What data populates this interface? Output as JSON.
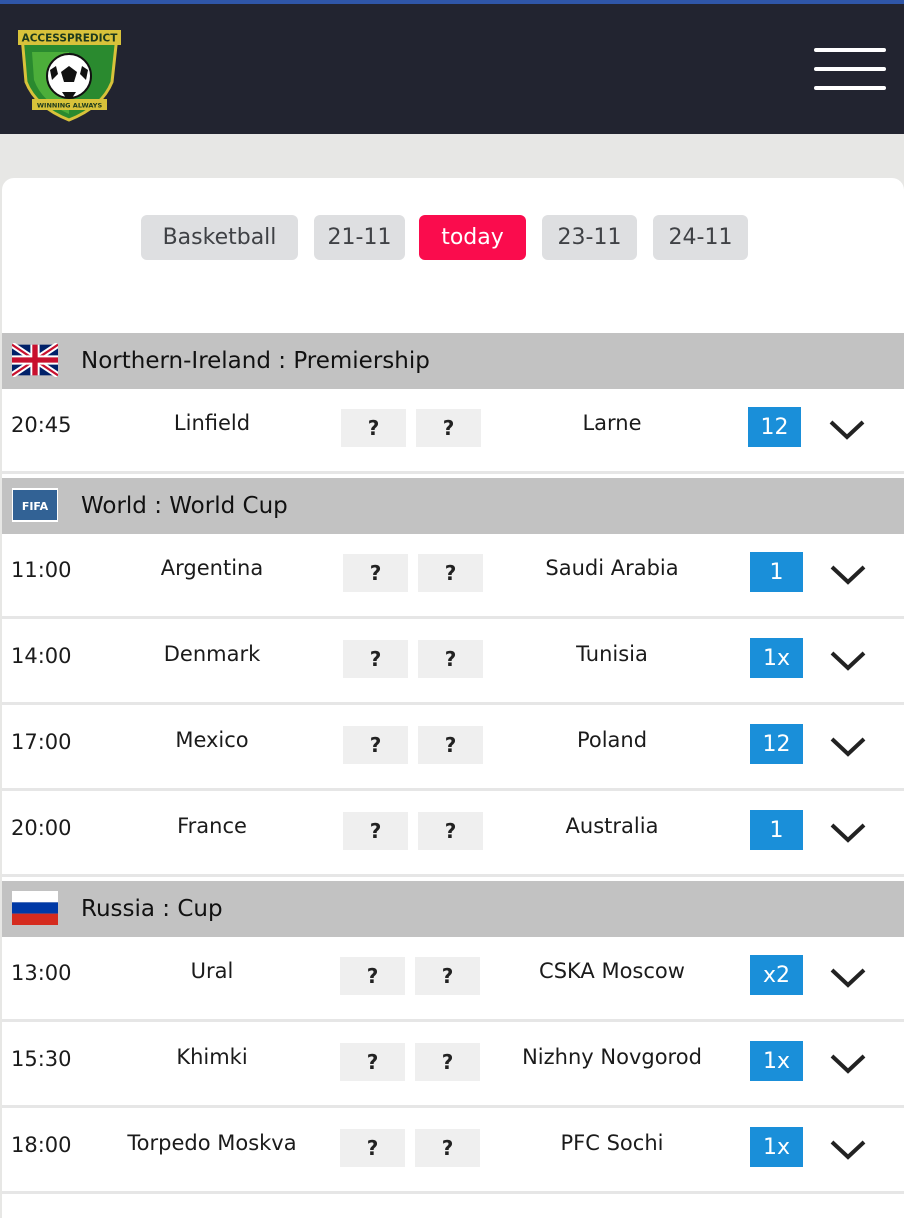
{
  "header": {
    "logo_title": "ACCESSPREDICT",
    "logo_tagline": "WINNING ALWAYS",
    "menu_icon": "hamburger-menu-icon",
    "background_color": "#222430"
  },
  "date_tabs": [
    {
      "label": "Basketball",
      "active": false
    },
    {
      "label": "21-11",
      "active": false
    },
    {
      "label": "today",
      "active": true
    },
    {
      "label": "23-11",
      "active": false
    },
    {
      "label": "24-11",
      "active": false
    }
  ],
  "colors": {
    "active_tab": "#fa0c4d",
    "tip_badge": "#1a8fd9",
    "league_bar": "#c2c2c2"
  },
  "leagues": [
    {
      "name": "Northern-Ireland : Premiership",
      "flag_icon": "uk-flag-icon",
      "matches": [
        {
          "time": "20:45",
          "home": "Linfield",
          "home_score": "?",
          "away_score": "?",
          "away": "Larne",
          "tip": "12"
        }
      ]
    },
    {
      "name": "World : World Cup",
      "flag_icon": "fifa-logo-icon",
      "flag_text": "FIFA",
      "matches": [
        {
          "time": "11:00",
          "home": "Argentina",
          "home_score": "?",
          "away_score": "?",
          "away": "Saudi Arabia",
          "tip": "1"
        },
        {
          "time": "14:00",
          "home": "Denmark",
          "home_score": "?",
          "away_score": "?",
          "away": "Tunisia",
          "tip": "1x"
        },
        {
          "time": "17:00",
          "home": "Mexico",
          "home_score": "?",
          "away_score": "?",
          "away": "Poland",
          "tip": "12"
        },
        {
          "time": "20:00",
          "home": "France",
          "home_score": "?",
          "away_score": "?",
          "away": "Australia",
          "tip": "1"
        }
      ]
    },
    {
      "name": "Russia : Cup",
      "flag_icon": "russia-flag-icon",
      "matches": [
        {
          "time": "13:00",
          "home": "Ural",
          "home_score": "?",
          "away_score": "?",
          "away": "CSKA Moscow",
          "tip": "x2"
        },
        {
          "time": "15:30",
          "home": "Khimki",
          "home_score": "?",
          "away_score": "?",
          "away": "Nizhny Novgorod",
          "tip": "1x"
        },
        {
          "time": "18:00",
          "home": "Torpedo Moskva",
          "home_score": "?",
          "away_score": "?",
          "away": "PFC Sochi",
          "tip": "1x"
        }
      ]
    }
  ]
}
